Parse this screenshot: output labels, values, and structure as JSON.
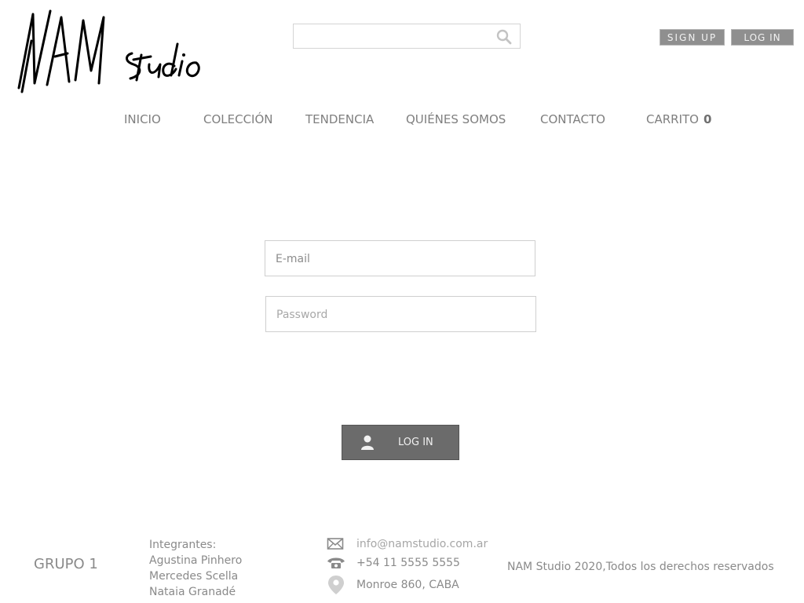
{
  "brand": {
    "logo_text_main": "NAM",
    "logo_text_sub": "studio"
  },
  "search": {
    "placeholder": "",
    "value": ""
  },
  "header": {
    "signup_label": "SIGN UP",
    "login_label": "LOG IN"
  },
  "nav": {
    "items": [
      {
        "label": "INICIO"
      },
      {
        "label": "COLECCIÓN"
      },
      {
        "label": "TENDENCIA"
      },
      {
        "label": "QUIÉNES SOMOS"
      },
      {
        "label": "CONTACTO"
      },
      {
        "label": "CARRITO"
      }
    ],
    "cart_count": "0"
  },
  "form": {
    "email_placeholder": "E-mail",
    "password_placeholder": "Password",
    "submit_label": "LOG IN"
  },
  "footer": {
    "group": "GRUPO 1",
    "members_title": "Integrantes:",
    "members": [
      "Agustina Pinhero",
      "Mercedes Scella",
      "Nataia Granadé"
    ],
    "email": "info@namstudio.com.ar",
    "phone": "+54 11 5555 5555",
    "address": "Monroe 860, CABA",
    "rights": "NAM Studio 2020,Todos los derechos reservados"
  }
}
